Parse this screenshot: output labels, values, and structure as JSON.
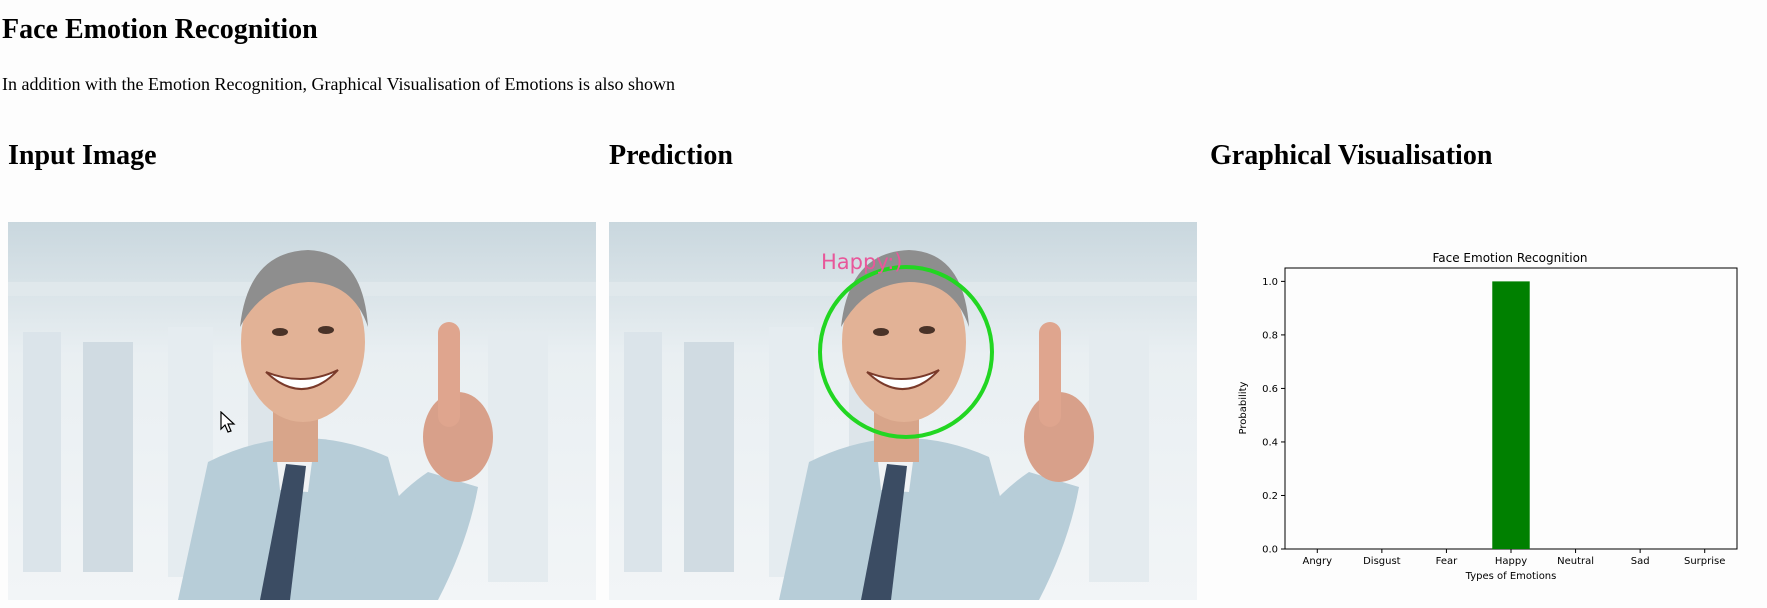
{
  "page": {
    "title": "Face Emotion Recognition",
    "subtitle": "In addition with the Emotion Recognition, Graphical Visualisation of Emotions is also shown"
  },
  "columns": {
    "input": {
      "heading": "Input Image"
    },
    "prediction": {
      "heading": "Prediction",
      "label": "Happy:)",
      "box_color": "#22d622",
      "label_color": "#e8579a"
    },
    "visualisation": {
      "heading": "Graphical Visualisation"
    }
  },
  "chart_data": {
    "type": "bar",
    "title": "Face Emotion Recognition",
    "xlabel": "Types of Emotions",
    "ylabel": "Probability",
    "categories": [
      "Angry",
      "Disgust",
      "Fear",
      "Happy",
      "Neutral",
      "Sad",
      "Surprise"
    ],
    "values": [
      0,
      0,
      0,
      1.0,
      0,
      0,
      0
    ],
    "ylim": [
      0,
      1.05
    ],
    "yticks": [
      "0.0",
      "0.2",
      "0.4",
      "0.6",
      "0.8",
      "1.0"
    ],
    "bar_color": "#008000",
    "grid": false
  }
}
